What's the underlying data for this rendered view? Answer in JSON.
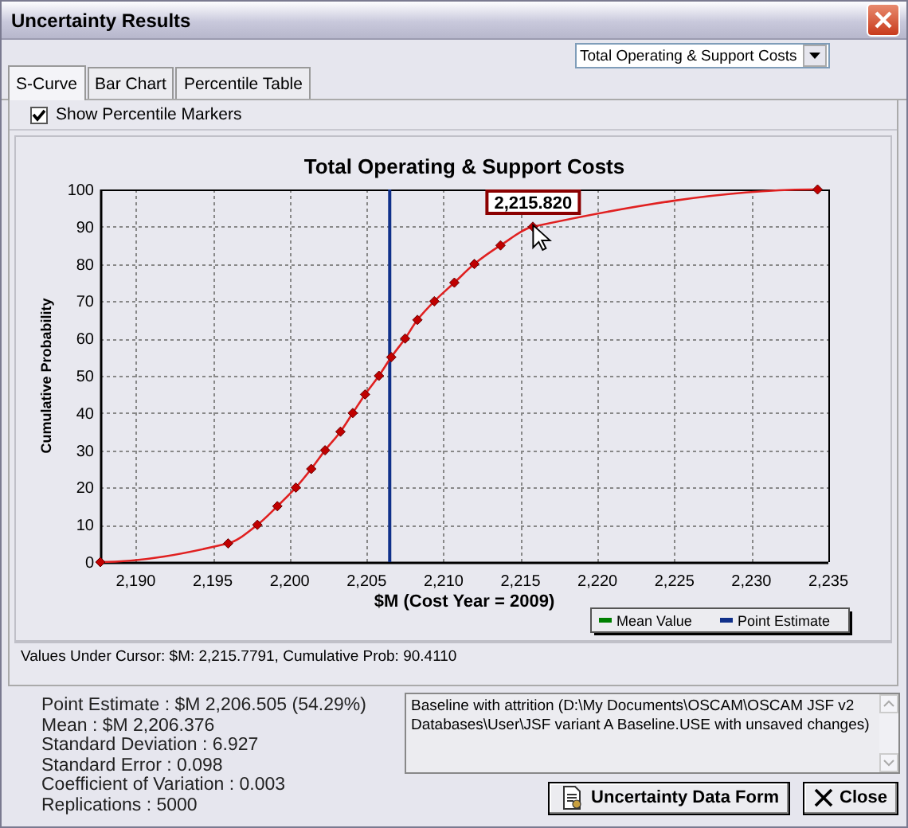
{
  "window": {
    "title": "Uncertainty Results"
  },
  "series_dropdown": {
    "value": "Total Operating & Support Costs"
  },
  "tabs": [
    {
      "label": "S-Curve",
      "selected": true
    },
    {
      "label": "Bar Chart",
      "selected": false
    },
    {
      "label": "Percentile Table",
      "selected": false
    }
  ],
  "percentile_markers": {
    "label": "Show Percentile Markers",
    "checked": true
  },
  "chart": {
    "chart_data": {
      "type": "line",
      "title": "Total Operating & Support Costs",
      "xlabel": "$M (Cost Year = 2009)",
      "ylabel": "Cumulative Probability",
      "x": [
        2187.7,
        2196.0,
        2197.9,
        2199.2,
        2200.4,
        2201.4,
        2202.3,
        2203.3,
        2204.1,
        2204.9,
        2205.8,
        2206.6,
        2207.5,
        2208.3,
        2209.4,
        2210.7,
        2212.0,
        2213.7,
        2215.8,
        2234.3
      ],
      "series": [
        {
          "color": "#e02020",
          "marker": "diamond",
          "values": [
            0,
            5,
            10,
            15,
            20,
            25,
            30,
            35,
            40,
            45,
            50,
            55,
            60,
            65,
            70,
            75,
            80,
            85,
            90,
            100
          ]
        }
      ],
      "xlim": [
        2187.7,
        2235
      ],
      "ylim": [
        0,
        100
      ],
      "xticks": [
        {
          "value": 2190,
          "label": "2,190"
        },
        {
          "value": 2195,
          "label": "2,195"
        },
        {
          "value": 2200,
          "label": "2,200"
        },
        {
          "value": 2205,
          "label": "2,205"
        },
        {
          "value": 2210,
          "label": "2,210"
        },
        {
          "value": 2215,
          "label": "2,215"
        },
        {
          "value": 2220,
          "label": "2,220"
        },
        {
          "value": 2225,
          "label": "2,225"
        },
        {
          "value": 2230,
          "label": "2,230"
        },
        {
          "value": 2235,
          "label": "2,235"
        }
      ],
      "yticks": [
        0,
        10,
        20,
        30,
        40,
        50,
        60,
        70,
        80,
        90,
        100
      ],
      "grid": true,
      "ref_lines": [
        {
          "axis": "x",
          "value": 2206.5,
          "color": "#10308a"
        }
      ],
      "annotations": [
        {
          "x": 2215.82,
          "y": 90.41,
          "text": "2,215.820"
        }
      ]
    },
    "legend": [
      {
        "label": "Mean Value",
        "color": "#008000"
      },
      {
        "label": "Point Estimate",
        "color": "#10308a"
      }
    ]
  },
  "cursor_readout": "Values Under Cursor: $M: 2,215.7791, Cumulative Prob: 90.4110",
  "statistics": [
    "Point Estimate : $M 2,206.505 (54.29%)",
    "Mean : $M 2,206.376",
    "Standard Deviation : 6.927",
    "Standard Error : 0.098",
    "Coefficient of Variation : 0.003",
    "Replications : 5000"
  ],
  "description": "Baseline with attrition (D:\\My Documents\\OSCAM\\OSCAM JSF v2 Databases\\User\\JSF variant A Baseline.USE with unsaved changes)",
  "buttons": [
    {
      "label": "Uncertainty Data Form",
      "kind": "form"
    },
    {
      "label": "Close",
      "kind": "close"
    }
  ]
}
